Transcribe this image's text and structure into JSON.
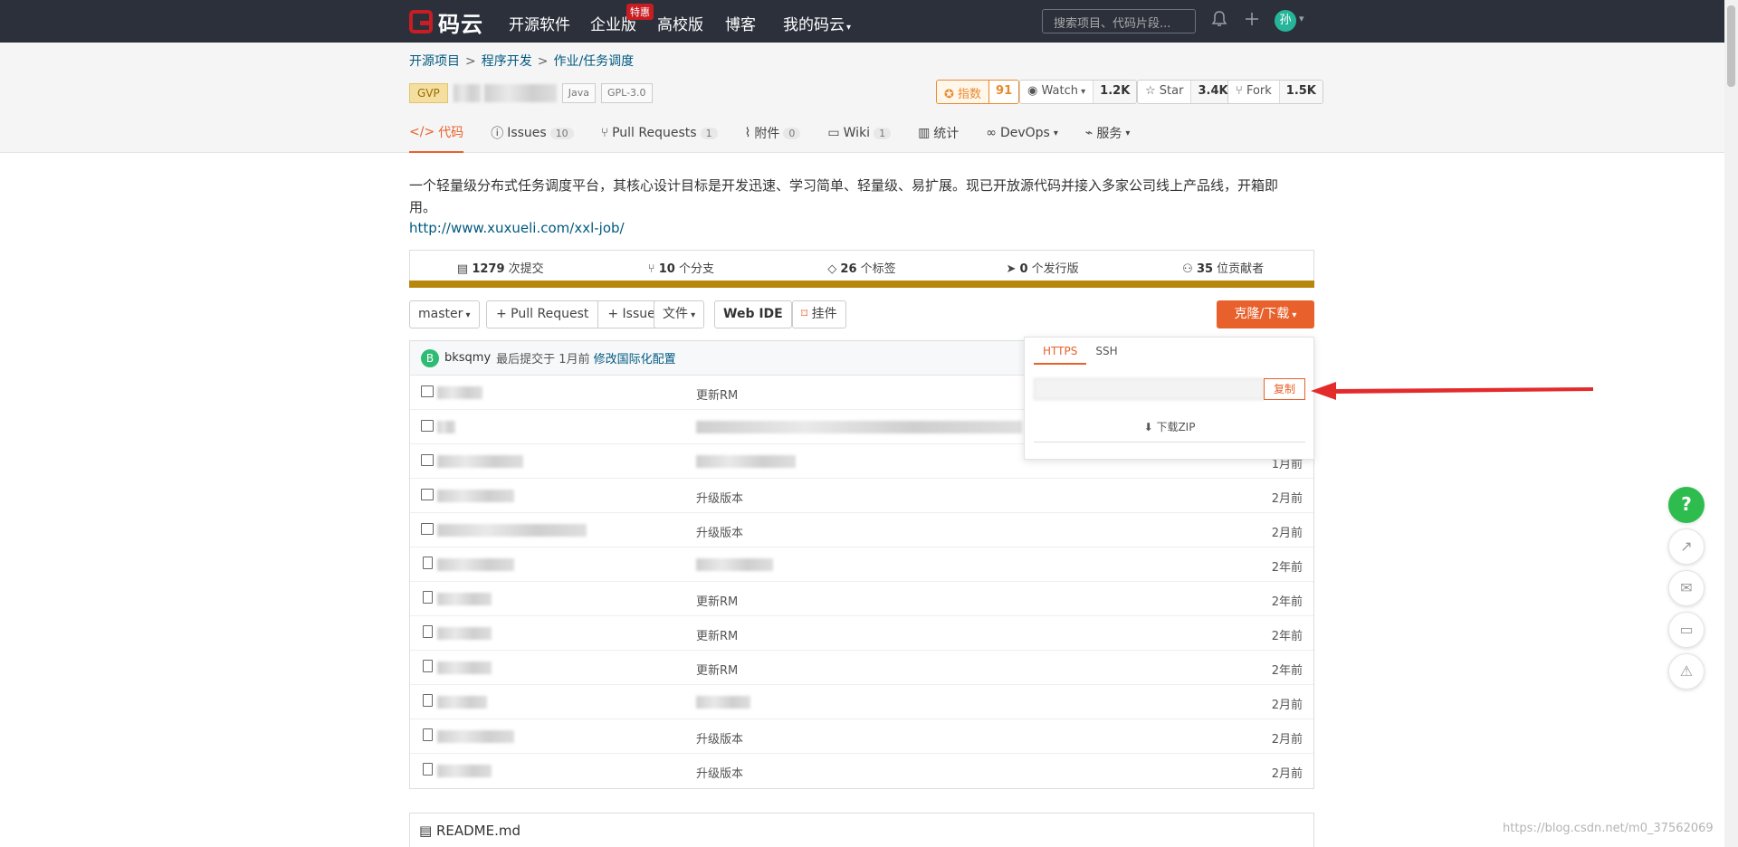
{
  "nav": {
    "logo": "码云",
    "items": [
      "开源软件",
      "企业版",
      "高校版",
      "博客",
      "我的码云"
    ],
    "hot_badge": "特惠",
    "search_placeholder": "搜索项目、代码片段...",
    "avatar_text": "孙"
  },
  "breadcrumb": [
    "开源项目",
    "程序开发",
    "作业/任务调度"
  ],
  "project": {
    "gvp": "GVP",
    "lang": "Java",
    "license": "GPL-3.0"
  },
  "stats": {
    "index_label": "指数",
    "index_value": "91",
    "watch_label": "Watch",
    "watch_value": "1.2K",
    "star_label": "Star",
    "star_value": "3.4K",
    "fork_label": "Fork",
    "fork_value": "1.5K"
  },
  "tabs": [
    {
      "label": "代码",
      "count": ""
    },
    {
      "label": "Issues",
      "count": "10"
    },
    {
      "label": "Pull Requests",
      "count": "1"
    },
    {
      "label": "附件",
      "count": "0"
    },
    {
      "label": "Wiki",
      "count": "1"
    },
    {
      "label": "统计",
      "count": ""
    },
    {
      "label": "DevOps",
      "count": ""
    },
    {
      "label": "服务",
      "count": ""
    }
  ],
  "description": "一个轻量级分布式任务调度平台，其核心设计目标是开发迅速、学习简单、轻量级、易扩展。现已开放源代码并接入多家公司线上产品线，开箱即用。",
  "homepage": "http://www.xuxueli.com/xxl-job/",
  "summary": [
    {
      "num": "1279",
      "text": "次提交"
    },
    {
      "num": "10",
      "text": "个分支"
    },
    {
      "num": "26",
      "text": "个标签"
    },
    {
      "num": "0",
      "text": "个发行版"
    },
    {
      "num": "35",
      "text": "位贡献者"
    }
  ],
  "toolbar": {
    "branch": "master",
    "pull_request": "+ Pull Request",
    "issue": "+ Issue",
    "file": "文件",
    "webide": "Web IDE",
    "widget": "挂件",
    "clone": "克隆/下载"
  },
  "commit": {
    "avatar": "B",
    "user": "bksqmy",
    "prefix": "最后提交于 1月前",
    "message": "修改国际化配置"
  },
  "files": [
    {
      "type": "folder",
      "msg": "更新RM",
      "time": ""
    },
    {
      "type": "folder",
      "msg": "",
      "time": ""
    },
    {
      "type": "folder",
      "msg": "",
      "time": "1月前"
    },
    {
      "type": "folder",
      "msg": "升级版本",
      "time": "2月前"
    },
    {
      "type": "folder",
      "msg": "升级版本",
      "time": "2月前"
    },
    {
      "type": "doc",
      "msg": "",
      "time": "2年前"
    },
    {
      "type": "doc",
      "msg": "更新RM",
      "time": "2年前"
    },
    {
      "type": "doc",
      "msg": "更新RM",
      "time": "2年前"
    },
    {
      "type": "doc",
      "msg": "更新RM",
      "time": "2年前"
    },
    {
      "type": "doc",
      "msg": "",
      "time": "2月前"
    },
    {
      "type": "doc",
      "msg": "升级版本",
      "time": "2月前"
    },
    {
      "type": "doc",
      "msg": "升级版本",
      "time": "2月前"
    }
  ],
  "clone_popup": {
    "tab_https": "HTTPS",
    "tab_ssh": "SSH",
    "copy": "复制",
    "download": "下载ZIP"
  },
  "readme": "README.md",
  "watermark": "https://blog.csdn.net/m0_37562069",
  "colors": {
    "accent": "#e8612c",
    "navbar": "#2b303b",
    "link": "#005980",
    "arrow": "#e32b2b"
  }
}
